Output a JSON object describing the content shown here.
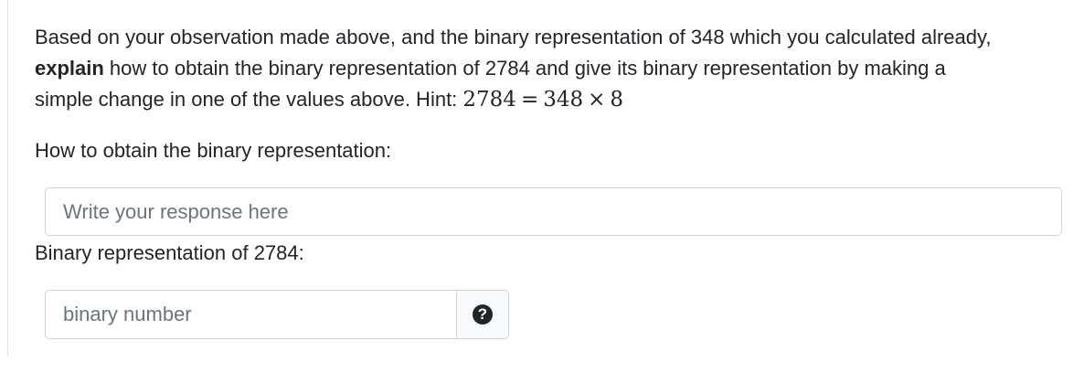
{
  "question": {
    "line1": "Based on your observation made above, and the binary representation of 348 which you calculated already,",
    "emphasis": "explain",
    "line2_rest": " how to obtain the binary representation of 2784 and give its binary representation by making a",
    "line3": "simple change in one of the values above. Hint: ",
    "hint_math": {
      "lhs": "2784",
      "equals": "=",
      "a": "348",
      "times": "×",
      "b": "8"
    }
  },
  "obtain_field": {
    "label": "How to obtain the binary representation:",
    "placeholder": "Write your response here",
    "value": ""
  },
  "binary_field": {
    "label": "Binary representation of 2784:",
    "placeholder": "binary number",
    "value": "",
    "help_icon_glyph": "?"
  },
  "icons": {
    "help": "question-circle-icon"
  }
}
